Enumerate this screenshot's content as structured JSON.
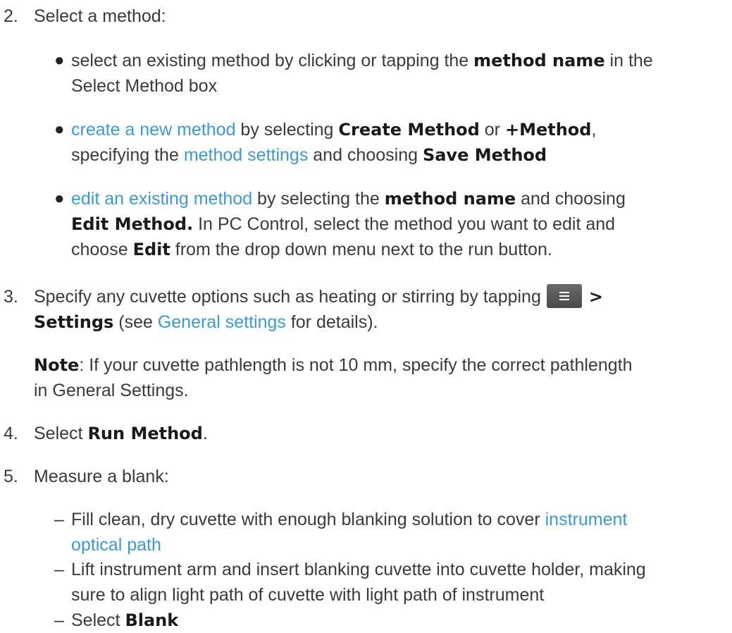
{
  "step2": {
    "num": "2.",
    "title": "Select a method:",
    "b1": {
      "t1": "select an existing method by clicking or tapping the ",
      "b1": "method name",
      "t2": " in the",
      "l2": "Select Method box"
    },
    "b2": {
      "link1": "create a new method",
      "t1": " by selecting ",
      "b1": "Create Method",
      "t2": " or ",
      "b2": "+Method",
      "t3": ",",
      "l2_t1": "specifying the ",
      "link2": "method settings",
      "l2_t2": " and choosing ",
      "b3": "Save Method"
    },
    "b3": {
      "link1": "edit an existing method",
      "t1": " by selecting the ",
      "b1": "method name",
      "t2": " and choosing",
      "b2": "Edit Method.",
      "l2_t": " In PC Control, select the method you want to edit and",
      "l3_t1": "choose ",
      "b3": "Edit",
      "l3_t2": " from the drop down menu next to the run button."
    }
  },
  "step3": {
    "num": "3.",
    "t1": "Specify any cuvette options such as heating or stirring by tapping",
    "arrow": ">",
    "b1": "Settings",
    "t2": " (see ",
    "link1": "General settings",
    "t3": " for details).",
    "note_label": "Note",
    "note_t1": ": If your cuvette pathlength is not 10 mm, specify the correct pathlength",
    "note_t2": "in General Settings."
  },
  "step4": {
    "num": "4.",
    "t1": "Select ",
    "b1": "Run Method",
    "t2": "."
  },
  "step5": {
    "num": "5.",
    "title": "Measure a blank:",
    "d1": {
      "t1": "Fill clean, dry cuvette with enough blanking solution to cover ",
      "link1": "instrument",
      "link2": "optical path"
    },
    "d2": {
      "l1": "Lift instrument arm and insert blanking cuvette into cuvette holder, making",
      "l2": "sure to align light path of cuvette with light path of instrument"
    },
    "d3": {
      "t1": "Select ",
      "b1": "Blank"
    }
  },
  "icons": {
    "menu": "hamburger-menu-icon"
  }
}
